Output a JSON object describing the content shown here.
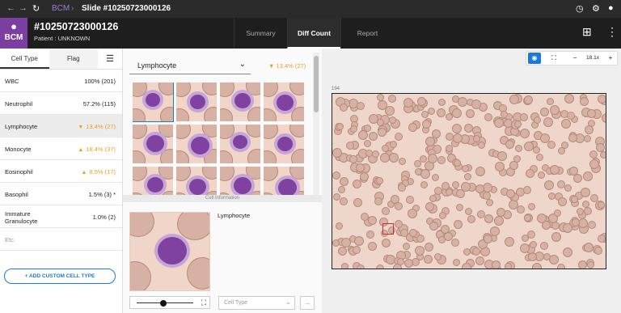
{
  "topbar": {
    "brand": "BCM",
    "slide_crumb": "Slide #10250723000126"
  },
  "header": {
    "logo_text": "BCM",
    "slide_title": "#10250723000126",
    "patient": "Patient : UNKNOWN",
    "tabs": [
      "Summary",
      "Diff Count",
      "Report"
    ]
  },
  "left_panel": {
    "tabs": [
      "Cell Type",
      "Flag"
    ],
    "rows": [
      {
        "name": "WBC",
        "value": "100% (201)",
        "trend": ""
      },
      {
        "name": "Neutrophil",
        "value": "57.2% (115)",
        "trend": ""
      },
      {
        "name": "Lymphocyte",
        "value": "13.4% (27)",
        "trend": "down"
      },
      {
        "name": "Monocyte",
        "value": "18.4% (37)",
        "trend": "up"
      },
      {
        "name": "Eosinophil",
        "value": "8.5% (17)",
        "trend": "up"
      },
      {
        "name": "Basophil",
        "value": "1.5% (3) *",
        "trend": ""
      },
      {
        "name": "Immature Granulocyte",
        "value": "1.0% (2)",
        "trend": ""
      },
      {
        "name": "Etc.",
        "value": "",
        "trend": ""
      }
    ],
    "add_button": "+ ADD CUSTOM CELL TYPE"
  },
  "middle_panel": {
    "selected_type": "Lymphocyte",
    "selected_pct": "13.4% (27)",
    "cell_info_label": "Cell Information",
    "detail_title": "Lymphocyte",
    "cell_type_placeholder": "Cell Type"
  },
  "right_panel": {
    "zoom": "18.1x",
    "scale_label": "194"
  },
  "colors": {
    "accent": "#1e78d8",
    "brand": "#7a3fa0",
    "warn": "#e8a020"
  }
}
